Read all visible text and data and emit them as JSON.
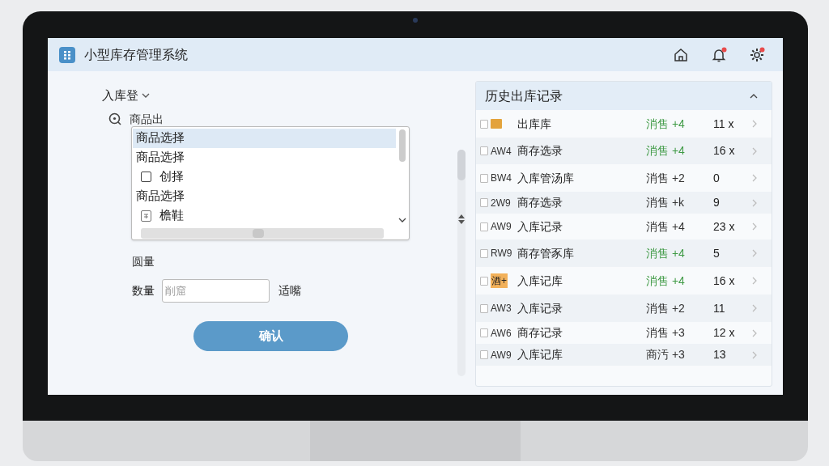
{
  "app": {
    "title": "小型库存管理系统",
    "header_icons": [
      {
        "kind": "home",
        "badge": false
      },
      {
        "kind": "bell",
        "badge": true
      },
      {
        "kind": "gear",
        "badge": true
      }
    ]
  },
  "form": {
    "section": "入库登",
    "product_label": "商品出",
    "dropdown": {
      "options": [
        {
          "kind": "text",
          "label": "商品选择",
          "selected": true
        },
        {
          "kind": "text",
          "label": "商品选择",
          "selected": false
        },
        {
          "kind": "checkbox",
          "label": "创择",
          "selected": false,
          "checked": false
        },
        {
          "kind": "text",
          "label": "商品选择",
          "selected": false
        },
        {
          "kind": "icon",
          "label": "檐鞋",
          "selected": false
        }
      ]
    },
    "quantity_heading": "圆量",
    "quantity_label": "数量",
    "quantity_placeholder": "削窟",
    "unit": "适嘴",
    "confirm": "确认"
  },
  "history": {
    "title": "历史出库记录",
    "rows": [
      {
        "kind": "icon",
        "code": "",
        "name": "出库库",
        "status": "消售 +4",
        "color": "#3f9a45",
        "qty": "11 x",
        "checked": false
      },
      {
        "kind": "code",
        "code": "AW4",
        "name": "商存选录",
        "status": "消售 +4",
        "color": "#3f9a45",
        "qty": "16 x",
        "checked": false
      },
      {
        "kind": "code",
        "code": "BW4",
        "name": "入库管汤库",
        "status": "消售 +2",
        "color": "#333333",
        "qty": "0",
        "checked": false
      },
      {
        "kind": "code",
        "code": "2W9",
        "name": "商存选录",
        "status": "消售 +k",
        "color": "#333333",
        "qty": "9",
        "checked": false
      },
      {
        "kind": "code",
        "code": "AW9",
        "name": "入库记录",
        "status": "消售 +4",
        "color": "#333333",
        "qty": "23 x",
        "checked": false
      },
      {
        "kind": "code",
        "code": "RW9",
        "name": "商存管豕库",
        "status": "消售 +4",
        "color": "#3f9a45",
        "qty": "5",
        "checked": false
      },
      {
        "kind": "highlight",
        "code": "酒+",
        "name": "入库记库",
        "status": "消售 +4",
        "color": "#3f9a45",
        "qty": "16 x",
        "checked": false
      },
      {
        "kind": "code",
        "code": "AW3",
        "name": "入库记录",
        "status": "消售 +2",
        "color": "#333333",
        "qty": "11",
        "checked": false
      },
      {
        "kind": "code",
        "code": "AW6",
        "name": "商存记录",
        "status": "消售 +3",
        "color": "#333333",
        "qty": "12 x",
        "checked": false
      },
      {
        "kind": "code",
        "code": "AW9",
        "name": "入库记库",
        "status": "商汚 +3",
        "color": "#333333",
        "qty": "13",
        "checked": false
      }
    ]
  }
}
